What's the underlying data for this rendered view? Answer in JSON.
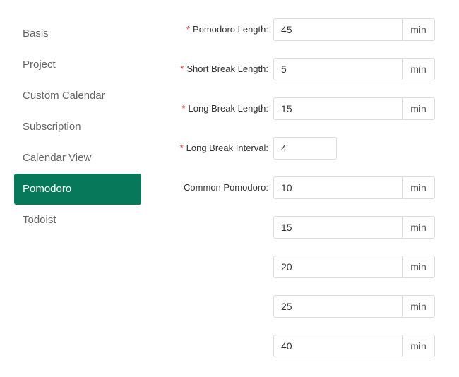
{
  "sidebar": {
    "items": [
      {
        "label": "Basis",
        "active": false
      },
      {
        "label": "Project",
        "active": false
      },
      {
        "label": "Custom Calendar",
        "active": false
      },
      {
        "label": "Subscription",
        "active": false
      },
      {
        "label": "Calendar View",
        "active": false
      },
      {
        "label": "Pomodoro",
        "active": true
      },
      {
        "label": "Todoist",
        "active": false
      }
    ]
  },
  "colors": {
    "active_bg": "#07795a",
    "required_star": "#e0302f"
  },
  "form": {
    "pomodoro_length": {
      "label": "Pomodoro Length:",
      "required": "*",
      "value": "45",
      "unit": "min"
    },
    "short_break_length": {
      "label": "Short Break Length:",
      "required": "*",
      "value": "5",
      "unit": "min"
    },
    "long_break_length": {
      "label": "Long Break Length:",
      "required": "*",
      "value": "15",
      "unit": "min"
    },
    "long_break_interval": {
      "label": "Long Break Interval:",
      "required": "*",
      "value": "4"
    },
    "common_pomodoro": {
      "label": "Common Pomodoro:",
      "unit": "min",
      "values": [
        "10",
        "15",
        "20",
        "25",
        "40"
      ]
    }
  }
}
